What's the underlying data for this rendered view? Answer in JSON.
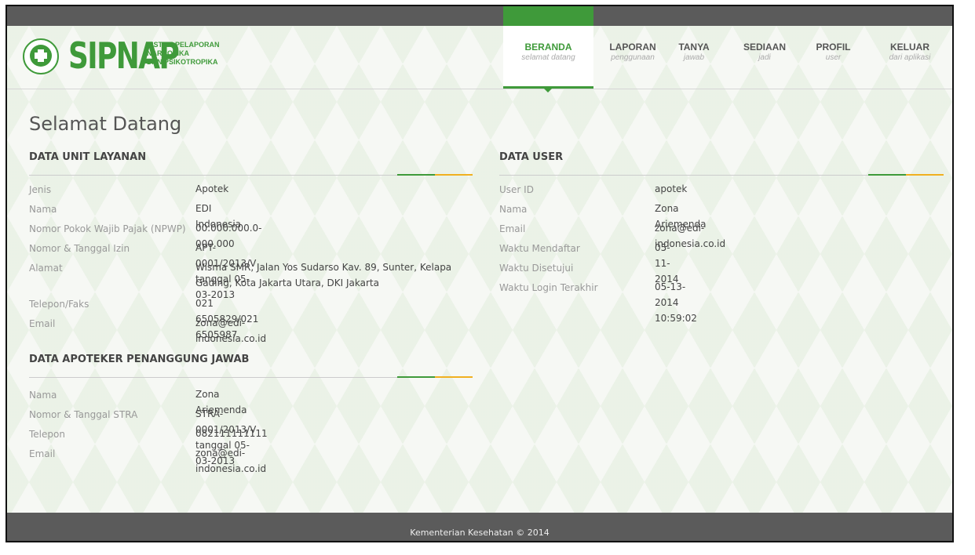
{
  "brand": {
    "name": "SIPNAP",
    "sub_line1": "SISTEM PELAPORAN",
    "sub_line2": "NARKOTIKA",
    "sub_line3": "DAN PSIKOTROPIKA"
  },
  "nav": [
    {
      "title": "BERANDA",
      "sub": "selamat datang"
    },
    {
      "title": "LAPORAN",
      "sub": "penggunaan"
    },
    {
      "title": "TANYA",
      "sub": "jawab"
    },
    {
      "title": "SEDIAAN",
      "sub": "jadi"
    },
    {
      "title": "PROFIL",
      "sub": "user"
    },
    {
      "title": "KELUAR",
      "sub": "dari aplikasi"
    }
  ],
  "page_title": "Selamat Datang",
  "unit": {
    "heading": "DATA UNIT LAYANAN",
    "rows": [
      {
        "label": "Jenis",
        "value": "Apotek"
      },
      {
        "label": "Nama",
        "value": "EDI Indonesia"
      },
      {
        "label": "Nomor Pokok Wajib Pajak (NPWP)",
        "value": "00.000.000.0-000.000"
      },
      {
        "label": "Nomor & Tanggal Izin",
        "value": "APT-0001/2013/V tanggal 05-03-2013"
      },
      {
        "label": "Alamat",
        "value": "Wisma SMR, Jalan Yos Sudarso Kav. 89, Sunter, Kelapa Gading, Kota Jakarta Utara, DKI Jakarta"
      },
      {
        "label": "Telepon/Faks",
        "value": "021 6505829/021 6505987"
      },
      {
        "label": "Email",
        "value": "zona@edi-indonesia.co.id"
      }
    ]
  },
  "apoteker": {
    "heading": "DATA APOTEKER PENANGGUNG JAWAB",
    "rows": [
      {
        "label": "Nama",
        "value": "Zona Ariemenda"
      },
      {
        "label": "Nomor & Tanggal STRA",
        "value": "STRA-0001/2013/V tanggal 05-03-2013"
      },
      {
        "label": "Telepon",
        "value": "082111111111"
      },
      {
        "label": "Email",
        "value": "zona@edi-indonesia.co.id"
      }
    ]
  },
  "user": {
    "heading": "DATA USER",
    "rows": [
      {
        "label": "User ID",
        "value": "apotek"
      },
      {
        "label": "Nama",
        "value": "Zona Ariemenda"
      },
      {
        "label": "Email",
        "value": "zona@edi-indonesia.co.id"
      },
      {
        "label": "Waktu Mendaftar",
        "value": "05-11-2014"
      },
      {
        "label": "Waktu Disetujui",
        "value": ""
      },
      {
        "label": "Waktu Login Terakhir",
        "value": "05-13-2014 10:59:02"
      }
    ]
  },
  "footer": "Kementerian Kesehatan © 2014",
  "colors": {
    "accent": "#3f9a3a",
    "yellow": "#f0b020",
    "bar": "#5b5b5b"
  }
}
